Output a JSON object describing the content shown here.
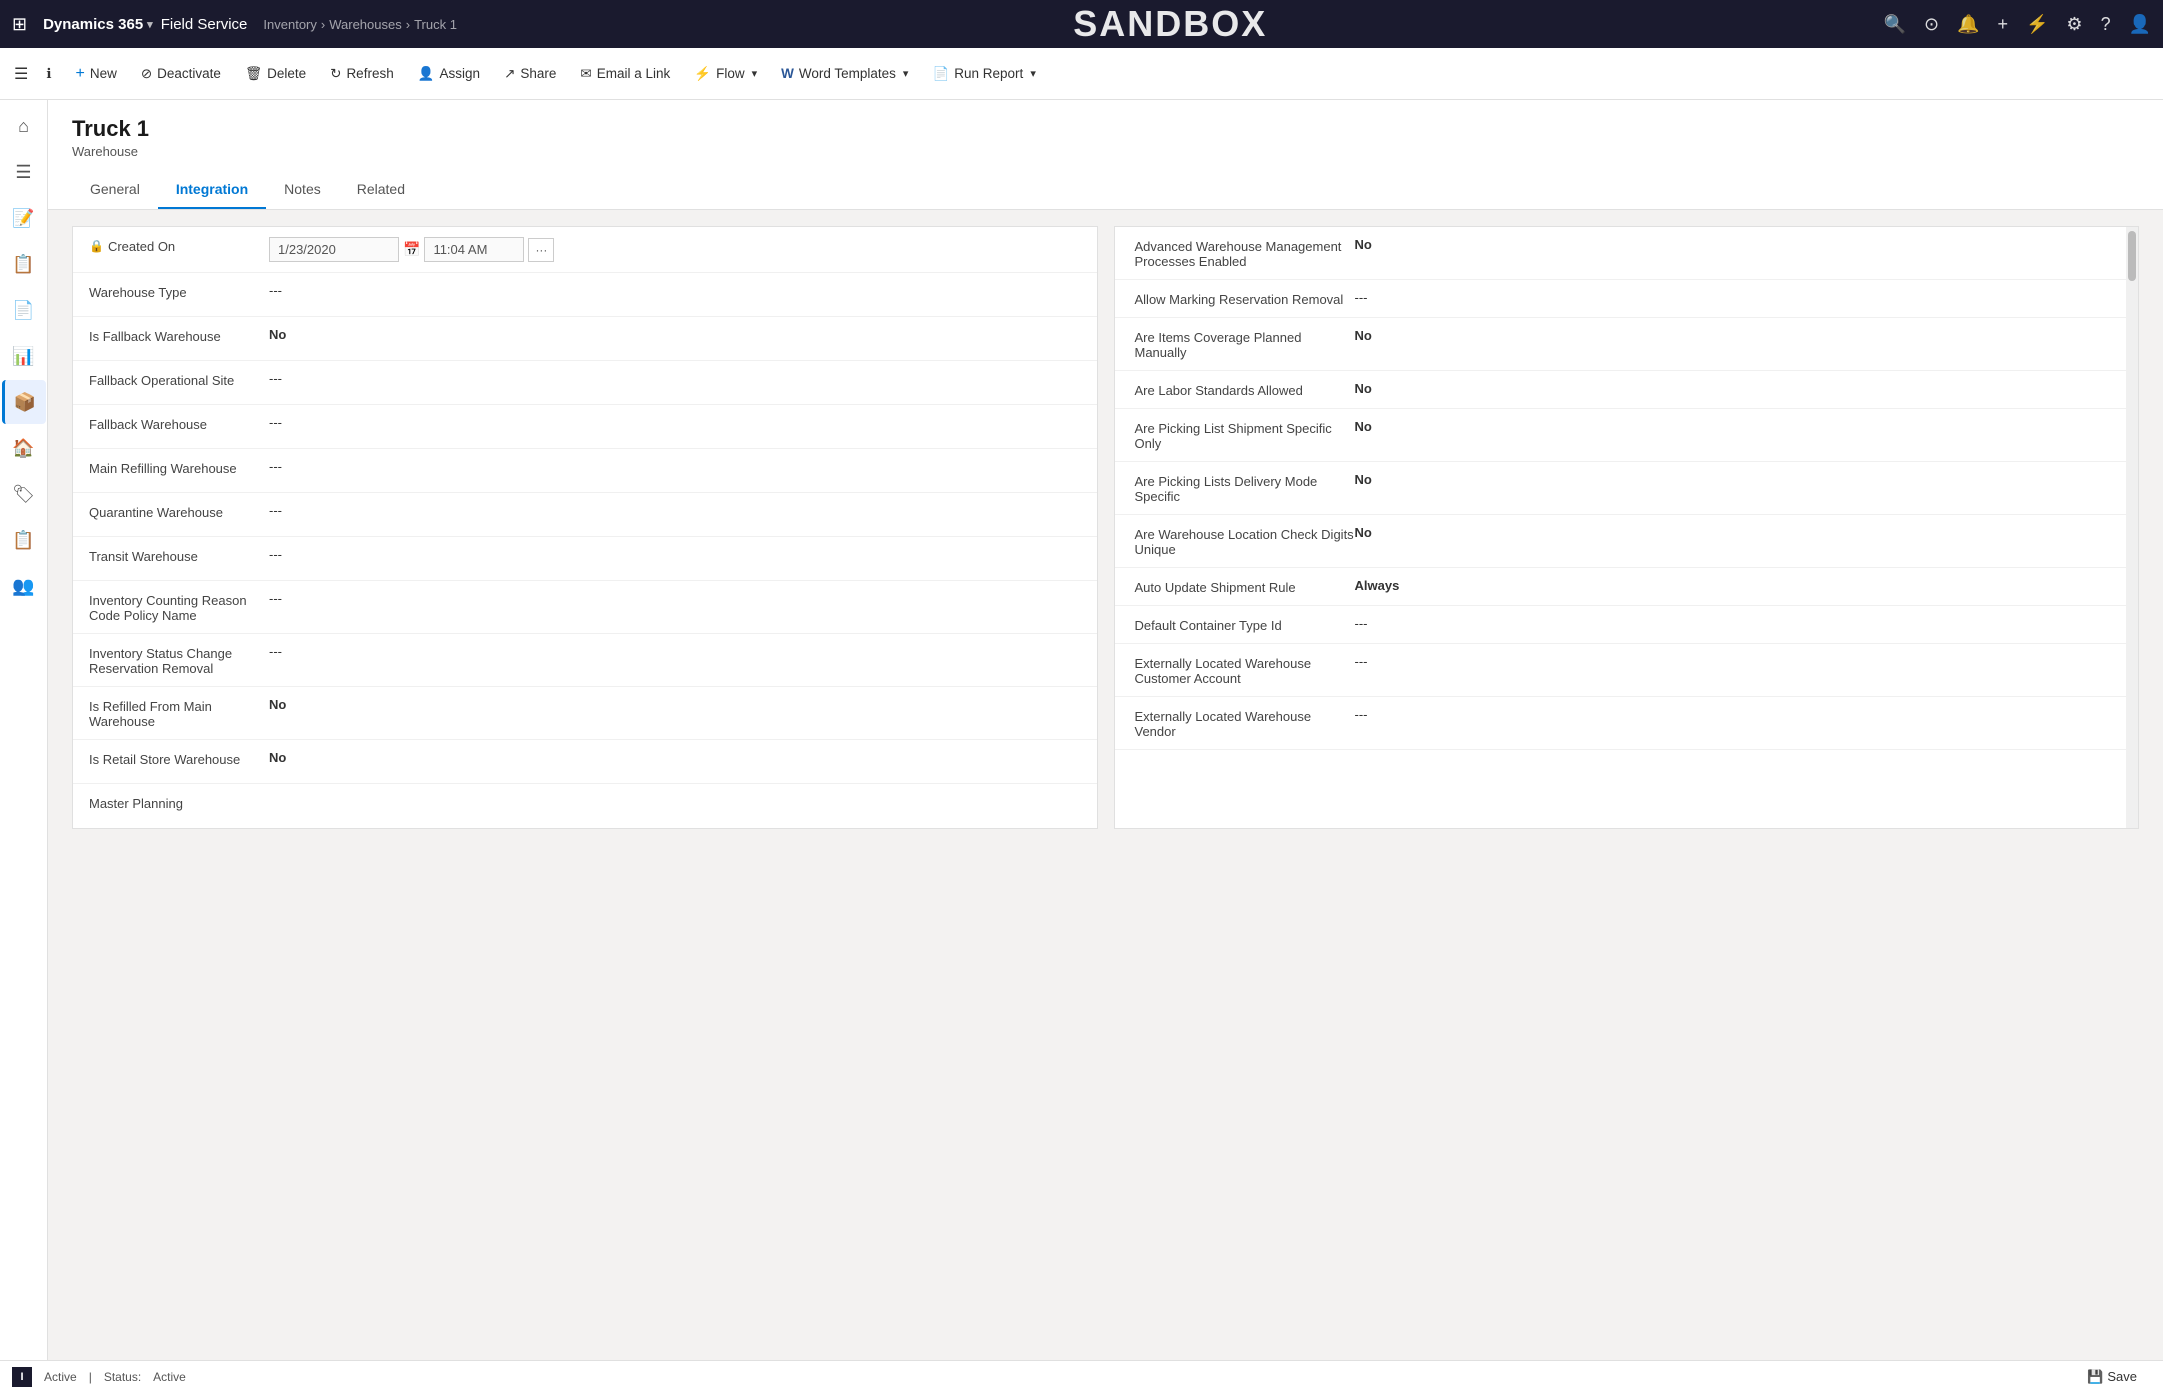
{
  "app": {
    "waffle": "⊞",
    "brand": "Dynamics 365",
    "brand_chevron": "▾",
    "module": "Field Service",
    "breadcrumb": [
      "Inventory",
      "Warehouses",
      "Truck 1"
    ],
    "sandbox_title": "SANDBOX"
  },
  "nav_icons": [
    "🔍",
    "⊙",
    "🔔",
    "+",
    "⚡",
    "⚙",
    "?",
    "👤"
  ],
  "command_bar": {
    "collapse_icon": "☰",
    "buttons": [
      {
        "id": "new",
        "label": "New",
        "icon": "+"
      },
      {
        "id": "deactivate",
        "label": "Deactivate",
        "icon": "⊘"
      },
      {
        "id": "delete",
        "label": "Delete",
        "icon": "🗑"
      },
      {
        "id": "refresh",
        "label": "Refresh",
        "icon": "↻"
      },
      {
        "id": "assign",
        "label": "Assign",
        "icon": "👤"
      },
      {
        "id": "share",
        "label": "Share",
        "icon": "↗"
      },
      {
        "id": "email-link",
        "label": "Email a Link",
        "icon": "✉"
      },
      {
        "id": "flow",
        "label": "Flow",
        "icon": "⚡",
        "has_caret": true
      },
      {
        "id": "word-templates",
        "label": "Word Templates",
        "icon": "W",
        "has_caret": true
      },
      {
        "id": "run-report",
        "label": "Run Report",
        "icon": "📄",
        "has_caret": true
      }
    ]
  },
  "sidebar_icons": [
    {
      "id": "home",
      "icon": "⌂",
      "active": false
    },
    {
      "id": "list",
      "icon": "☰",
      "active": false
    },
    {
      "id": "notes",
      "icon": "📝",
      "active": false
    },
    {
      "id": "notes2",
      "icon": "📋",
      "active": false
    },
    {
      "id": "doc",
      "icon": "📄",
      "active": false
    },
    {
      "id": "chart",
      "icon": "📊",
      "active": false
    },
    {
      "id": "active-item",
      "icon": "📦",
      "active": true
    },
    {
      "id": "box",
      "icon": "🏠",
      "active": false
    },
    {
      "id": "tag",
      "icon": "🏷",
      "active": false
    },
    {
      "id": "report",
      "icon": "📋",
      "active": false
    },
    {
      "id": "users",
      "icon": "👥",
      "active": false
    }
  ],
  "record": {
    "title": "Truck 1",
    "subtitle": "Warehouse",
    "tabs": [
      {
        "id": "general",
        "label": "General",
        "active": false
      },
      {
        "id": "integration",
        "label": "Integration",
        "active": true
      },
      {
        "id": "notes",
        "label": "Notes",
        "active": false
      },
      {
        "id": "related",
        "label": "Related",
        "active": false
      }
    ]
  },
  "left_form": {
    "rows": [
      {
        "id": "created-on",
        "label": "Created On",
        "has_lock": true,
        "date_value": "1/23/2020",
        "time_value": "11:04 AM",
        "is_date": true
      },
      {
        "id": "warehouse-type",
        "label": "Warehouse Type",
        "value": "---"
      },
      {
        "id": "is-fallback-warehouse",
        "label": "Is Fallback Warehouse",
        "value": "No",
        "bold": true
      },
      {
        "id": "fallback-operational-site",
        "label": "Fallback Operational Site",
        "value": "---"
      },
      {
        "id": "fallback-warehouse",
        "label": "Fallback Warehouse",
        "value": "---"
      },
      {
        "id": "main-refilling-warehouse",
        "label": "Main Refilling Warehouse",
        "value": "---"
      },
      {
        "id": "quarantine-warehouse",
        "label": "Quarantine Warehouse",
        "value": "---"
      },
      {
        "id": "transit-warehouse",
        "label": "Transit Warehouse",
        "value": "---"
      },
      {
        "id": "inventory-counting-reason",
        "label": "Inventory Counting Reason Code Policy Name",
        "value": "---"
      },
      {
        "id": "inventory-status-change",
        "label": "Inventory Status Change Reservation Removal",
        "value": "---"
      },
      {
        "id": "is-refilled-from-main",
        "label": "Is Refilled From Main Warehouse",
        "value": "No",
        "bold": true
      },
      {
        "id": "is-retail-store",
        "label": "Is Retail Store Warehouse",
        "value": "No",
        "bold": true
      },
      {
        "id": "master-planning",
        "label": "Master Planning",
        "value": "..."
      }
    ]
  },
  "right_form": {
    "rows": [
      {
        "id": "advanced-warehouse",
        "label": "Advanced Warehouse Management Processes Enabled",
        "value": "No",
        "bold": true
      },
      {
        "id": "allow-marking",
        "label": "Allow Marking Reservation Removal",
        "value": "---"
      },
      {
        "id": "are-items-coverage",
        "label": "Are Items Coverage Planned Manually",
        "value": "No",
        "bold": true
      },
      {
        "id": "are-labor-standards",
        "label": "Are Labor Standards Allowed",
        "value": "No",
        "bold": true
      },
      {
        "id": "are-picking-list-shipment",
        "label": "Are Picking List Shipment Specific Only",
        "value": "No",
        "bold": true
      },
      {
        "id": "are-picking-lists-delivery",
        "label": "Are Picking Lists Delivery Mode Specific",
        "value": "No",
        "bold": true
      },
      {
        "id": "are-warehouse-location",
        "label": "Are Warehouse Location Check Digits Unique",
        "value": "No",
        "bold": true
      },
      {
        "id": "auto-update-shipment",
        "label": "Auto Update Shipment Rule",
        "value": "Always",
        "bold": true
      },
      {
        "id": "default-container",
        "label": "Default Container Type Id",
        "value": "---"
      },
      {
        "id": "externally-located-customer",
        "label": "Externally Located Warehouse Customer Account",
        "value": "---"
      },
      {
        "id": "externally-located-vendor",
        "label": "Externally Located Warehouse Vendor",
        "value": "---"
      }
    ]
  },
  "status_bar": {
    "user_initial": "I",
    "active_label": "Active",
    "status_label": "Status:",
    "status_value": "Active",
    "save_label": "Save"
  }
}
